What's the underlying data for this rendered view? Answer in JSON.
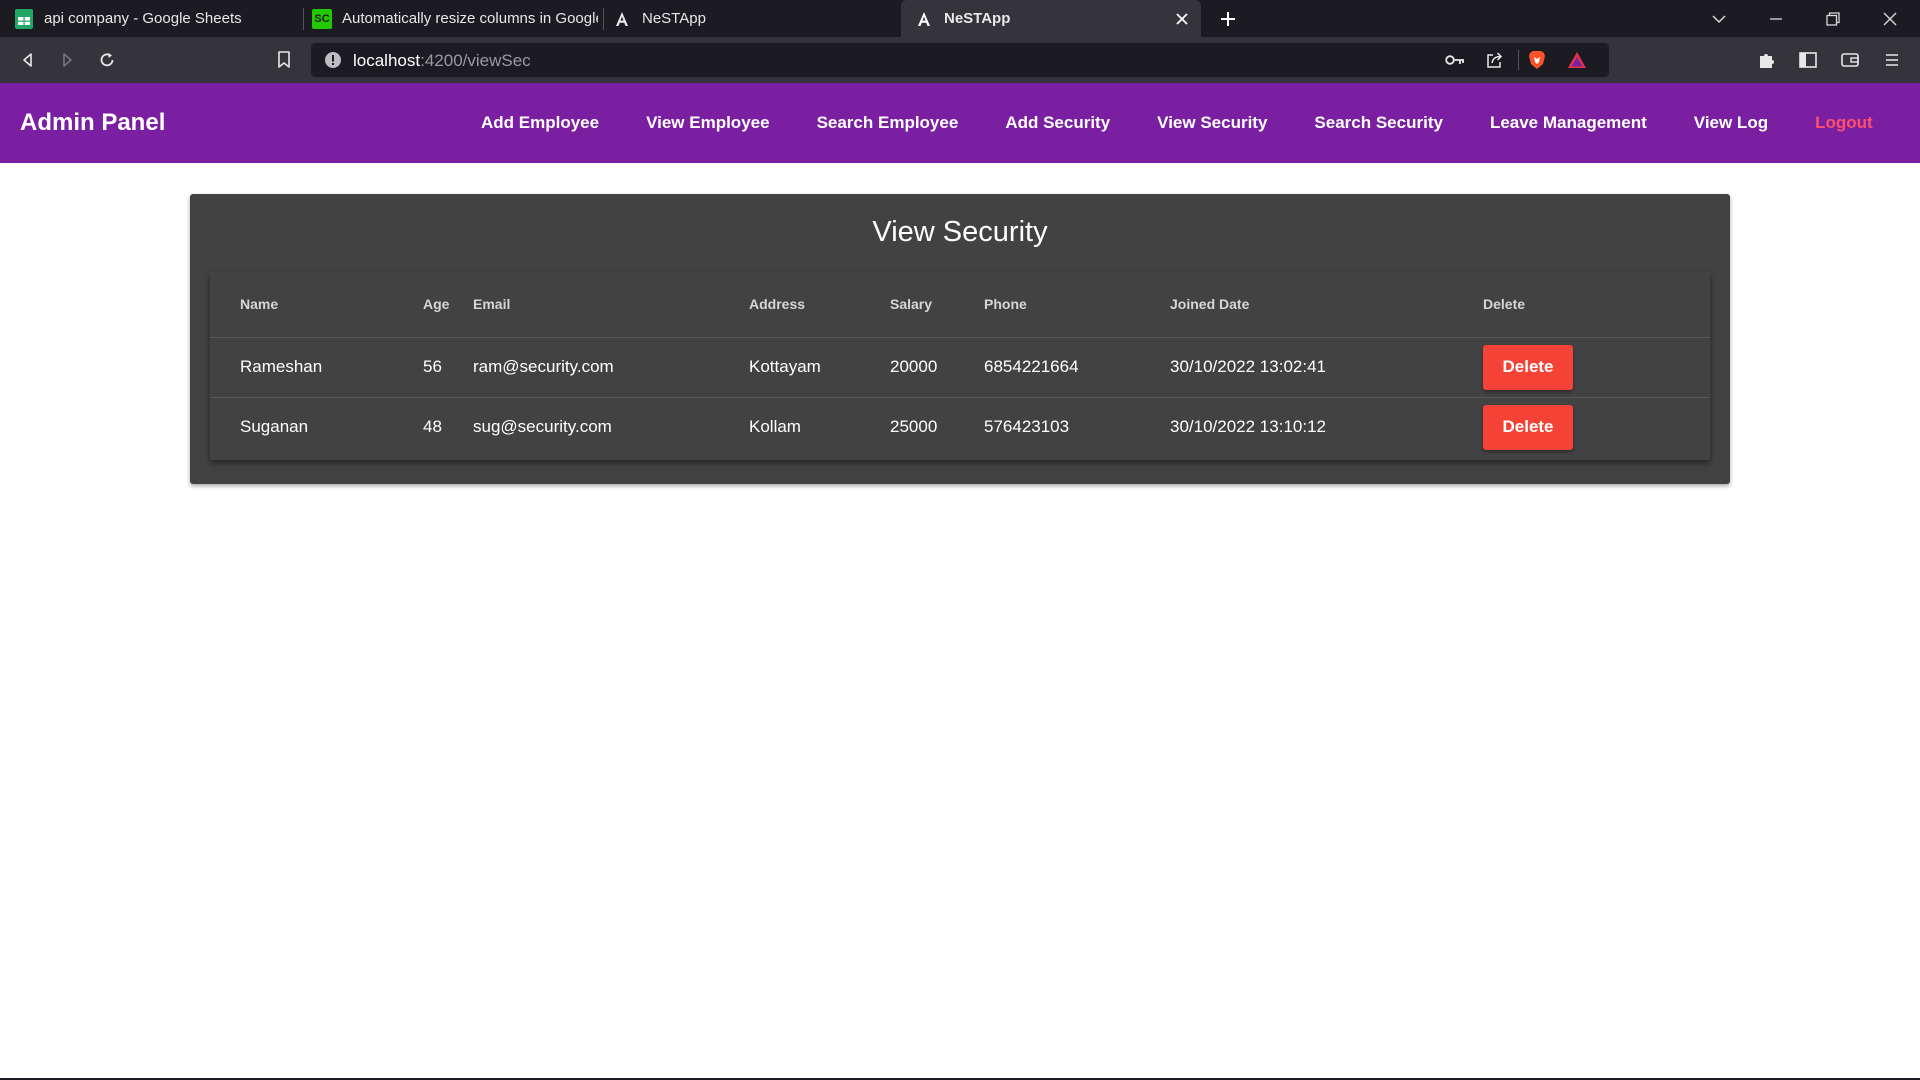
{
  "browser": {
    "tabs": [
      {
        "title": "api company - Google Sheets",
        "icon": "google-sheets-icon"
      },
      {
        "title": "Automatically resize columns in Google",
        "icon": "sc-icon",
        "icon_text": "SC"
      },
      {
        "title": "NeSTApp",
        "icon": "angular-icon"
      },
      {
        "title": "NeSTApp",
        "icon": "angular-icon"
      }
    ],
    "url_host": "localhost",
    "url_path": ":4200/viewSec"
  },
  "navbar": {
    "brand": "Admin Panel",
    "links": [
      "Add Employee",
      "View Employee",
      "Search Employee",
      "Add Security",
      "View Security",
      "Search Security",
      "Leave Management",
      "View Log"
    ],
    "logout": "Logout",
    "bg_color": "#7b1fa2",
    "logout_color": "#ff4f6d"
  },
  "card": {
    "title": "View Security",
    "columns": [
      "Name",
      "Age",
      "Email",
      "Address",
      "Salary",
      "Phone",
      "Joined Date",
      "Delete"
    ],
    "rows": [
      {
        "name": "Rameshan",
        "age": "56",
        "email": "ram@security.com",
        "address": "Kottayam",
        "salary": "20000",
        "phone": "6854221664",
        "joined": "30/10/2022 13:02:41",
        "action": "Delete"
      },
      {
        "name": "Suganan",
        "age": "48",
        "email": "sug@security.com",
        "address": "Kollam",
        "salary": "25000",
        "phone": "576423103",
        "joined": "30/10/2022 13:10:12",
        "action": "Delete"
      }
    ],
    "delete_color": "#f44336"
  }
}
